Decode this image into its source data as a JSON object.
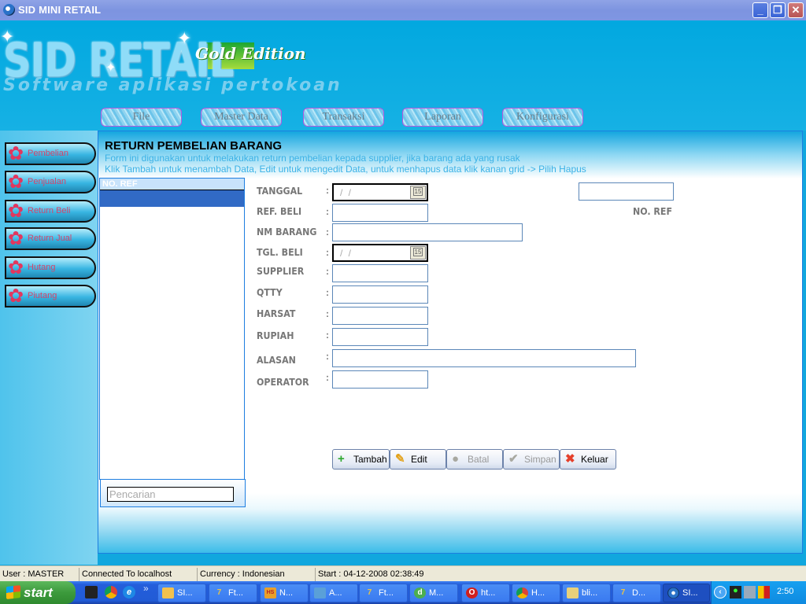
{
  "window": {
    "title": "SID MINI RETAIL",
    "controls": {
      "minimize": "_",
      "restore": "❐",
      "close": "✕"
    }
  },
  "banner": {
    "logo": "SID RETAIL",
    "edition": "Gold Edition",
    "subtitle": "Software aplikasi pertokoan"
  },
  "menu": [
    {
      "label": "File"
    },
    {
      "label": "Master Data"
    },
    {
      "label": "Transaksi"
    },
    {
      "label": "Laporan"
    },
    {
      "label": "Konfigurasi"
    }
  ],
  "sidebar": {
    "items": [
      {
        "label": "Pembelian",
        "icon": "flower-icon"
      },
      {
        "label": "Penjualan",
        "icon": "flower-icon"
      },
      {
        "label": "Return Beli",
        "icon": "flower-icon"
      },
      {
        "label": "Return Jual",
        "icon": "flower-icon"
      },
      {
        "label": "Hutang",
        "icon": "flower-icon"
      },
      {
        "label": "Piutang",
        "icon": "flower-icon"
      }
    ]
  },
  "form": {
    "title": "RETURN PEMBELIAN BARANG",
    "desc1": "Form ini digunakan untuk melakukan return pembelian kepada supplier, jika barang ada yang rusak",
    "desc2": "Klik Tambah untuk menambah Data, Edit untuk mengedit Data, untuk menhapus data klik kanan grid -> Pilih Hapus",
    "grid": {
      "columns": [
        "NO. REF"
      ],
      "rows": []
    },
    "search_placeholder": "Pencarian",
    "colon": ":",
    "fields": {
      "tanggal": {
        "label": "TANGGAL",
        "value": " /  / "
      },
      "ref_beli": {
        "label": "REF. BELI",
        "value": ""
      },
      "nm_barang": {
        "label": "NM BARANG",
        "value": ""
      },
      "tgl_beli": {
        "label": "TGL. BELI",
        "value": " /  / "
      },
      "supplier": {
        "label": "SUPPLIER",
        "value": ""
      },
      "qtty": {
        "label": "QTTY",
        "value": ""
      },
      "harsat": {
        "label": "HARSAT",
        "value": ""
      },
      "rupiah": {
        "label": "RUPIAH",
        "value": ""
      },
      "alasan": {
        "label": "ALASAN",
        "value": ""
      },
      "operator": {
        "label": "OPERATOR",
        "value": ""
      },
      "no_ref": {
        "label": "NO. REF",
        "value": ""
      }
    },
    "calendar_icon_text": "15",
    "buttons": {
      "tambah": {
        "label": "Tambah",
        "icon": "+",
        "color": "#2fa82f",
        "enabled": true
      },
      "edit": {
        "label": "Edit",
        "icon": "✎",
        "color": "#e3a21a",
        "enabled": true
      },
      "batal": {
        "label": "Batal",
        "icon": "●",
        "color": "#a8a8a0",
        "enabled": false
      },
      "simpan": {
        "label": "Simpan",
        "icon": "✔",
        "color": "#a8a8a0",
        "enabled": false
      },
      "keluar": {
        "label": "Keluar",
        "icon": "✖",
        "color": "#e5402b",
        "enabled": true
      }
    }
  },
  "statusbar": {
    "user": "User : MASTER",
    "connection": "Connected To localhost",
    "currency": "Currency : Indonesian",
    "start": "Start  : 04-12-2008 02:38:49"
  },
  "taskbar": {
    "start_label": "start",
    "quick_more": "»",
    "tasks": [
      {
        "label": "SI...",
        "icon": "folder-icon",
        "active": false
      },
      {
        "label": "Ft...",
        "icon": "7zip-icon",
        "active": false
      },
      {
        "label": "N...",
        "icon": "hs-icon",
        "active": false
      },
      {
        "label": "A...",
        "icon": "media-icon",
        "active": false
      },
      {
        "label": "Ft...",
        "icon": "7zip-icon",
        "active": false
      },
      {
        "label": "M...",
        "icon": "dreamweaver-icon",
        "active": false
      },
      {
        "label": "ht...",
        "icon": "opera-icon",
        "active": false
      },
      {
        "label": "H...",
        "icon": "chrome-icon",
        "active": false
      },
      {
        "label": "bli...",
        "icon": "zip-folder-icon",
        "active": false
      },
      {
        "label": "D...",
        "icon": "7zip-icon",
        "active": false
      },
      {
        "label": "SI...",
        "icon": "app-globe-icon",
        "active": true
      }
    ],
    "clock": "2:50"
  }
}
